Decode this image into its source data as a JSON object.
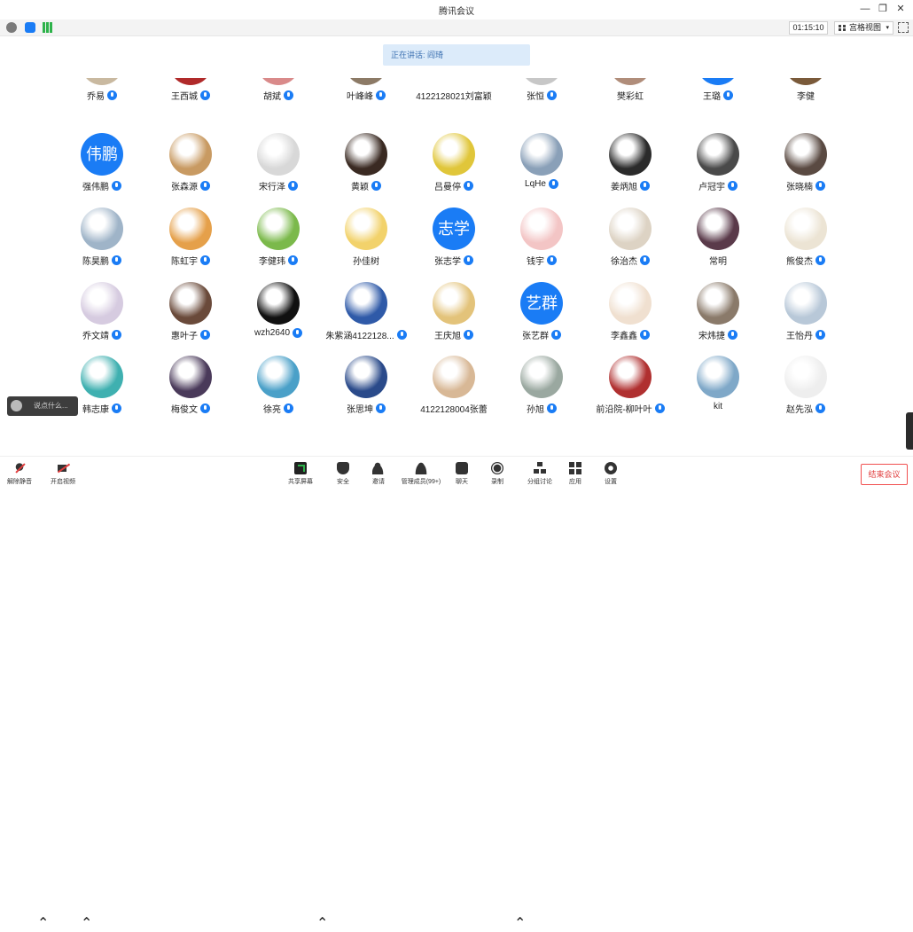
{
  "window": {
    "title": "腾讯会议",
    "minimize": "—",
    "restore": "❐",
    "close": "✕"
  },
  "infobar": {
    "timer": "01:15:10",
    "view_label": "宫格视图",
    "view_caret": "▾",
    "colors": {
      "info": "#7a7a7a",
      "shield": "#1a7cf5",
      "signal": "#2db24a"
    }
  },
  "speaking": "正在讲话: 阎琦",
  "participants": [
    {
      "name": "乔易",
      "mic": true,
      "img": "#c9b9a0"
    },
    {
      "name": "王西城",
      "mic": true,
      "img": "#b02a2a"
    },
    {
      "name": "胡斌",
      "mic": true,
      "img": "#d98a8a"
    },
    {
      "name": "叶峰峰",
      "mic": true,
      "img": "#8c7a66"
    },
    {
      "name": "4122128021刘富颖",
      "mic": false,
      "img": "#ffffff"
    },
    {
      "name": "张恒",
      "mic": true,
      "img": "#c7c7c7"
    },
    {
      "name": "樊彩虹",
      "mic": false,
      "img": "#b08d7a"
    },
    {
      "name": "王璐",
      "mic": true,
      "text": "王璐"
    },
    {
      "name": "李健",
      "mic": false,
      "img": "#7a5a3a"
    },
    {
      "name": "强伟鹏",
      "mic": true,
      "text": "伟鹏"
    },
    {
      "name": "张森源",
      "mic": true,
      "img": "#c89a62"
    },
    {
      "name": "宋行泽",
      "mic": true,
      "img": "#d8d8d8"
    },
    {
      "name": "黄颖",
      "mic": true,
      "img": "#3a2a22"
    },
    {
      "name": "吕曼停",
      "mic": true,
      "img": "#e0c63a"
    },
    {
      "name": "LqHe",
      "mic": true,
      "img": "#8aa0b8"
    },
    {
      "name": "姜炳旭",
      "mic": true,
      "img": "#2b2b2b"
    },
    {
      "name": "卢冠宇",
      "mic": true,
      "img": "#4a4a4a"
    },
    {
      "name": "张晓楠",
      "mic": true,
      "img": "#5a4a42"
    },
    {
      "name": "陈昊鹏",
      "mic": true,
      "img": "#9fb4c8"
    },
    {
      "name": "陈虹宇",
      "mic": true,
      "img": "#e5a04a"
    },
    {
      "name": "李健玮",
      "mic": true,
      "img": "#7bb94b"
    },
    {
      "name": "孙佳树",
      "mic": false,
      "img": "#f2d26b"
    },
    {
      "name": "张志学",
      "mic": true,
      "text": "志学"
    },
    {
      "name": "钱宇",
      "mic": true,
      "img": "#f3c5c5"
    },
    {
      "name": "徐治杰",
      "mic": true,
      "img": "#ddd3c4"
    },
    {
      "name": "常明",
      "mic": false,
      "img": "#5a3a4a"
    },
    {
      "name": "熊俊杰",
      "mic": true,
      "img": "#ece4d4"
    },
    {
      "name": "乔文靖",
      "mic": true,
      "img": "#d6cbe0"
    },
    {
      "name": "惠叶子",
      "mic": true,
      "img": "#6a4a3a"
    },
    {
      "name": "wzh2640",
      "mic": true,
      "img": "#111111"
    },
    {
      "name": "朱紫涵4122128...",
      "mic": true,
      "img": "#2f5aa8"
    },
    {
      "name": "王庆旭",
      "mic": true,
      "img": "#e3c37a"
    },
    {
      "name": "张艺群",
      "mic": true,
      "text": "艺群"
    },
    {
      "name": "李鑫鑫",
      "mic": true,
      "img": "#f0e0d0"
    },
    {
      "name": "宋炜捷",
      "mic": true,
      "img": "#8a7a6a"
    },
    {
      "name": "王怡丹",
      "mic": true,
      "img": "#b8c8d8"
    },
    {
      "name": "韩志康",
      "mic": true,
      "img": "#3fb0b0"
    },
    {
      "name": "梅俊文",
      "mic": true,
      "img": "#4a3a5a"
    },
    {
      "name": "徐亮",
      "mic": true,
      "img": "#4aa0c8"
    },
    {
      "name": "张思坤",
      "mic": true,
      "img": "#2a4a8a"
    },
    {
      "name": "4122128004张蕾",
      "mic": false,
      "img": "#d8b896"
    },
    {
      "name": "孙旭",
      "mic": true,
      "img": "#9aa8a0"
    },
    {
      "name": "前沿院-柳叶叶",
      "mic": true,
      "img": "#b03030"
    },
    {
      "name": "kit",
      "mic": false,
      "img": "#7fa8c8"
    },
    {
      "name": "赵先泓",
      "mic": true,
      "img": "#eeeeee"
    }
  ],
  "chat": {
    "placeholder": "说点什么..."
  },
  "toolbar": {
    "mute": "解除静音",
    "video": "开启视频",
    "share": "共享屏幕",
    "security": "安全",
    "invite": "邀请",
    "members": "管理成员(99+)",
    "chat": "聊天",
    "record": "录制",
    "breakout": "分组讨论",
    "apps": "应用",
    "settings": "设置",
    "end": "结束会议",
    "accent": "#1a7cf5",
    "end_color": "#e03c3c"
  }
}
